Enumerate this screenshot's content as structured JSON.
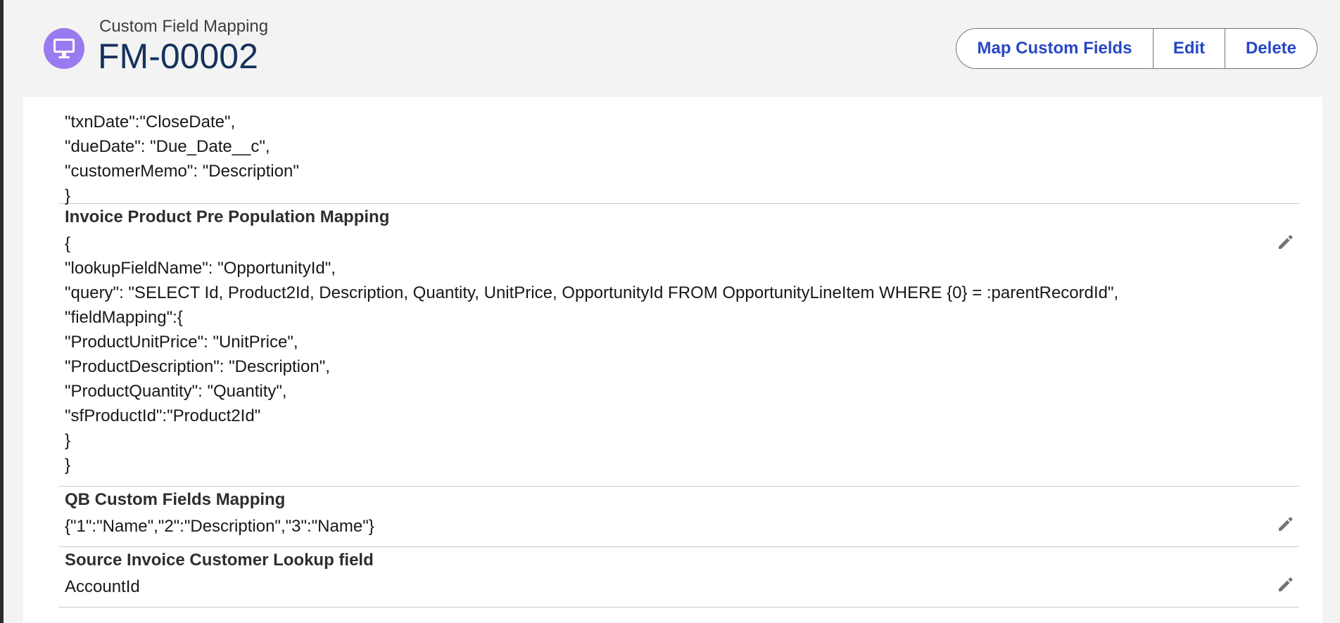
{
  "header": {
    "object_label": "Custom Field Mapping",
    "record_title": "FM-00002",
    "icon": "desktop-icon",
    "icon_color": "#9a7bef"
  },
  "actions": {
    "map_custom_fields": "Map Custom Fields",
    "edit": "Edit",
    "delete": "Delete"
  },
  "fields": {
    "partial": {
      "lines": [
        "\"txnDate\":\"CloseDate\",",
        "\"dueDate\": \"Due_Date__c\",",
        "\"customerMemo\": \"Description\"",
        "}"
      ]
    },
    "invoice_product": {
      "label": "Invoice Product Pre Population Mapping",
      "lines": [
        "{",
        "\"lookupFieldName\": \"OpportunityId\",",
        "\"query\": \"SELECT Id, Product2Id, Description, Quantity, UnitPrice, OpportunityId FROM OpportunityLineItem WHERE {0} = :parentRecordId\",",
        "\"fieldMapping\":{",
        "\"ProductUnitPrice\": \"UnitPrice\",",
        "\"ProductDescription\": \"Description\",",
        "\"ProductQuantity\": \"Quantity\",",
        "\"sfProductId\":\"Product2Id\"",
        "}",
        "}"
      ]
    },
    "qb_custom": {
      "label": "QB Custom Fields Mapping",
      "lines": [
        "{\"1\":\"Name\",\"2\":\"Description\",\"3\":\"Name\"}"
      ]
    },
    "source_lookup": {
      "label": "Source Invoice Customer Lookup field",
      "lines": [
        "AccountId"
      ]
    }
  },
  "colors": {
    "accent": "#2747c4",
    "title": "#16325c",
    "divider": "#c9c9c9"
  }
}
